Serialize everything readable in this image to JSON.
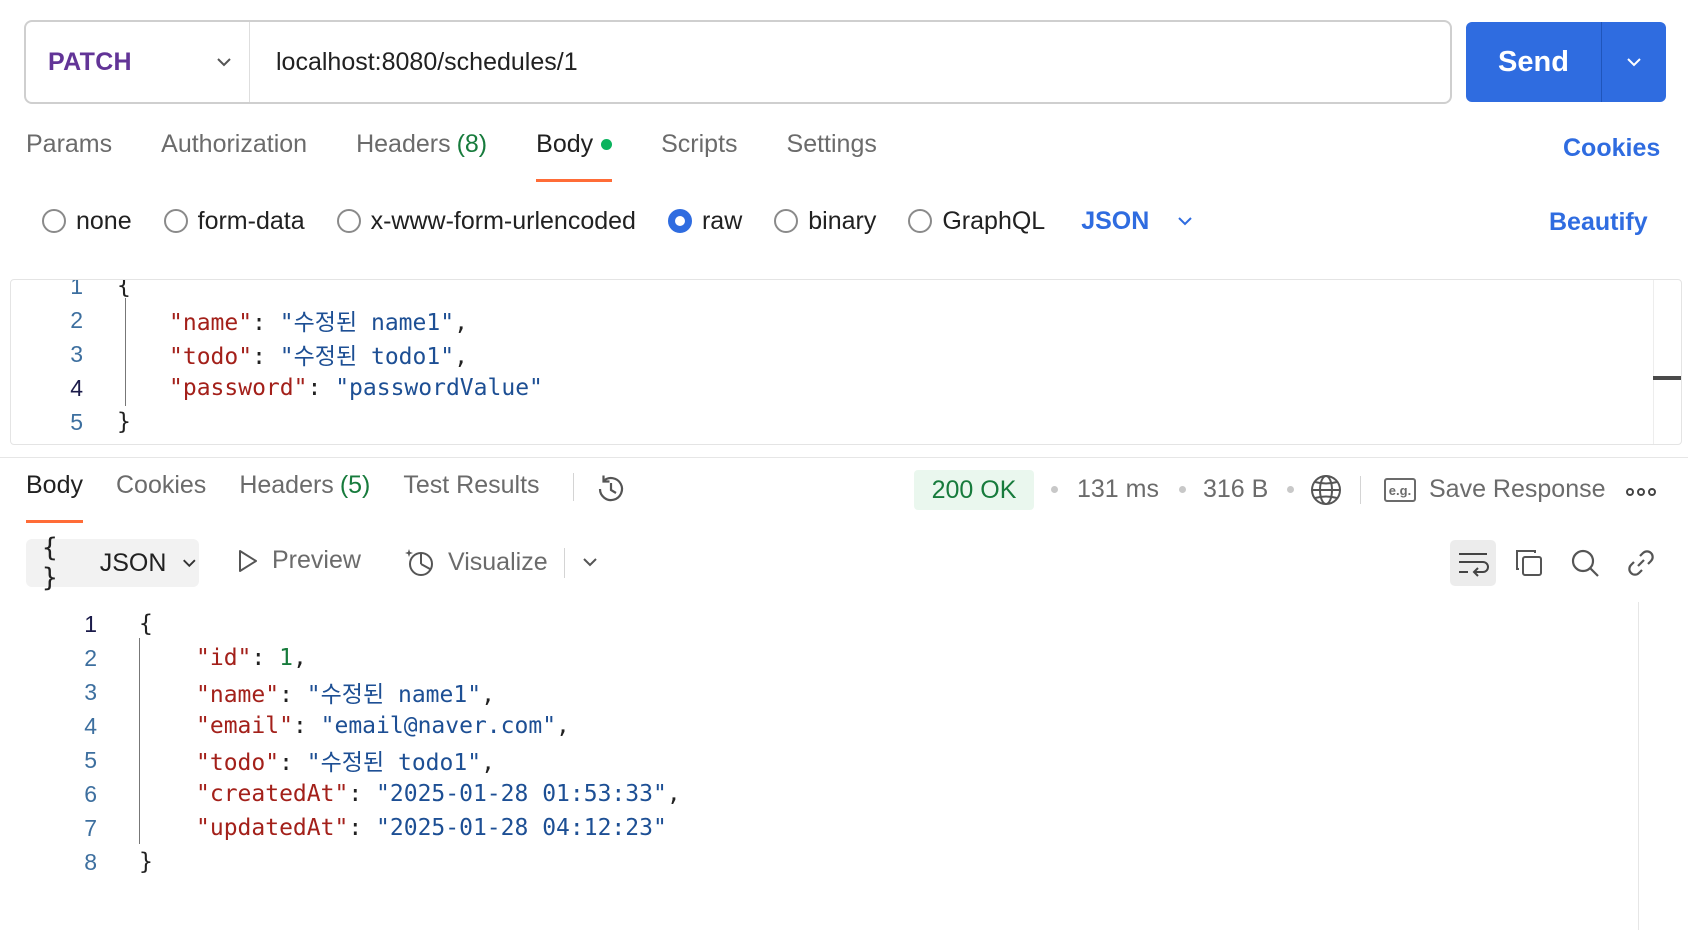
{
  "request": {
    "method": "PATCH",
    "url": "localhost:8080/schedules/1",
    "send_label": "Send"
  },
  "request_tabs": [
    {
      "label": "Params"
    },
    {
      "label": "Authorization"
    },
    {
      "label": "Headers",
      "count": "(8)"
    },
    {
      "label": "Body"
    },
    {
      "label": "Scripts"
    },
    {
      "label": "Settings"
    }
  ],
  "cookies_label": "Cookies",
  "body_types": [
    "none",
    "form-data",
    "x-www-form-urlencoded",
    "raw",
    "binary",
    "GraphQL"
  ],
  "body_selected": "raw",
  "body_format": "JSON",
  "beautify_label": "Beautify",
  "request_body": {
    "line_numbers": [
      "1",
      "2",
      "3",
      "4",
      "5"
    ],
    "open": "{",
    "fields": [
      {
        "key": "\"name\"",
        "value": "\"수정된 name1\"",
        "comma": ","
      },
      {
        "key": "\"todo\"",
        "value": "\"수정된 todo1\"",
        "comma": ","
      },
      {
        "key": "\"password\"",
        "value": "\"passwordValue\"",
        "comma": ""
      }
    ],
    "close": "}"
  },
  "response_tabs": [
    {
      "label": "Body"
    },
    {
      "label": "Cookies"
    },
    {
      "label": "Headers",
      "count": "(5)"
    },
    {
      "label": "Test Results"
    }
  ],
  "response_meta": {
    "status": "200 OK",
    "time": "131 ms",
    "size": "316 B",
    "save_label": "Save Response",
    "eg_label": "e.g."
  },
  "response_toolbar": {
    "format": "JSON",
    "braces": "{ }",
    "preview": "Preview",
    "visualize": "Visualize"
  },
  "response_body": {
    "line_numbers": [
      "1",
      "2",
      "3",
      "4",
      "5",
      "6",
      "7",
      "8"
    ],
    "open": "{",
    "fields": [
      {
        "key": "\"id\"",
        "value": "1",
        "type": "number",
        "comma": ","
      },
      {
        "key": "\"name\"",
        "value": "\"수정된 name1\"",
        "type": "string",
        "comma": ","
      },
      {
        "key": "\"email\"",
        "value": "\"email@naver.com\"",
        "type": "string",
        "comma": ","
      },
      {
        "key": "\"todo\"",
        "value": "\"수정된 todo1\"",
        "type": "string",
        "comma": ","
      },
      {
        "key": "\"createdAt\"",
        "value": "\"2025-01-28 01:53:33\"",
        "type": "string",
        "comma": ","
      },
      {
        "key": "\"updatedAt\"",
        "value": "\"2025-01-28 04:12:23\"",
        "type": "string",
        "comma": ""
      }
    ],
    "close": "}"
  },
  "colors": {
    "accent": "#2f6ce0",
    "method": "#623497",
    "tab_underline": "#ff6c37",
    "status_green": "#177b3c",
    "json_key": "#a3201a",
    "json_string": "#1d4f94",
    "json_number": "#177b3c"
  }
}
